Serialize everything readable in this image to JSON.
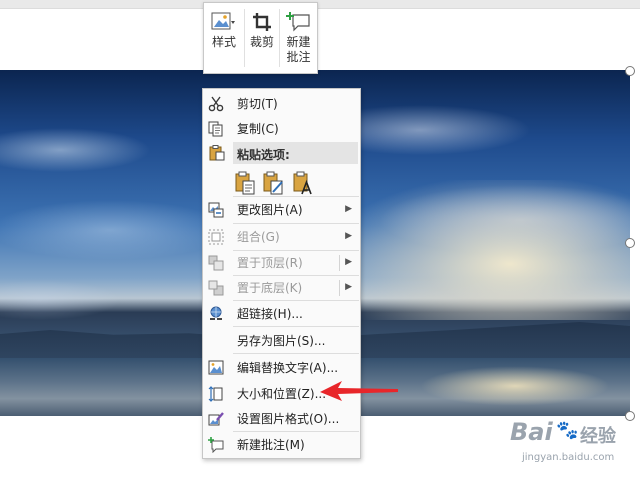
{
  "mini_toolbar": {
    "style_label": "样式",
    "crop_label": "裁剪",
    "comment_label_line1": "新建",
    "comment_label_line2": "批注"
  },
  "context_menu": {
    "items": [
      {
        "label": "剪切(T)",
        "icon": "scissors-icon",
        "enabled": true
      },
      {
        "label": "复制(C)",
        "icon": "copy-icon",
        "enabled": true
      },
      {
        "label": "粘贴选项:",
        "icon": "paste-icon",
        "enabled": true
      },
      {
        "label": "更改图片(A)",
        "icon": "change-picture-icon",
        "enabled": true,
        "submenu": true
      },
      {
        "label": "组合(G)",
        "icon": "group-icon",
        "enabled": false,
        "submenu": true
      },
      {
        "label": "置于顶层(R)",
        "icon": "bring-to-front-icon",
        "enabled": false,
        "submenu": true
      },
      {
        "label": "置于底层(K)",
        "icon": "send-to-back-icon",
        "enabled": false,
        "submenu": true
      },
      {
        "label": "超链接(H)...",
        "icon": "hyperlink-icon",
        "enabled": true
      },
      {
        "label": "另存为图片(S)...",
        "icon": "",
        "enabled": true
      },
      {
        "label": "编辑替换文字(A)...",
        "icon": "alt-text-icon",
        "enabled": true
      },
      {
        "label": "大小和位置(Z)...",
        "icon": "size-position-icon",
        "enabled": true
      },
      {
        "label": "设置图片格式(O)...",
        "icon": "format-picture-icon",
        "enabled": true
      },
      {
        "label": "新建批注(M)",
        "icon": "new-comment-icon",
        "enabled": true
      }
    ],
    "paste_options": [
      "paste-keep-format-icon",
      "paste-picture-icon",
      "paste-text-only-icon"
    ]
  },
  "annotation": {
    "arrow_color": "#e8262a",
    "points_to": "大小和位置(Z)..."
  },
  "watermark": {
    "brand": "Bai",
    "brand_suffix": "经验",
    "url": "jingyan.baidu.com"
  },
  "colors": {
    "menu_bg": "#fafafa",
    "paste_header_bg": "#e4e4e4",
    "disabled_text": "#9a9a9a",
    "accent_icon": "#2f6fb7"
  }
}
